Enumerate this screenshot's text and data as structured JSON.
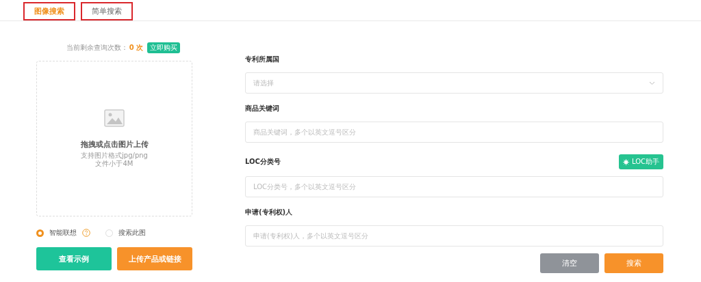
{
  "tabs": [
    {
      "label": "图像搜索",
      "selected": true,
      "annotated": true
    },
    {
      "label": "简单搜索",
      "selected": false,
      "annotated": true
    }
  ],
  "quota": {
    "label": "当前剩余查询次数：",
    "count": "0 次",
    "buy_button": "立即购买"
  },
  "upload": {
    "title": "拖拽或点击图片上传",
    "hint_lines": [
      "支持图片格式jpg/png",
      "文件小于4M"
    ]
  },
  "modes": [
    {
      "label": "智能联想",
      "selected": true,
      "help": true
    },
    {
      "label": "搜索此图",
      "selected": false,
      "help": false
    }
  ],
  "left_buttons": [
    {
      "label": "查看示例",
      "kind": "green"
    },
    {
      "label": "上传产品或链接",
      "kind": "orange"
    }
  ],
  "fields": [
    {
      "label": "专利所属国",
      "kind": "select",
      "placeholder": "请选择"
    },
    {
      "label": "商品关键词",
      "kind": "input",
      "placeholder": "商品关键词，多个以英文逗号区分"
    },
    {
      "label": "LOC分类号",
      "kind": "input",
      "placeholder": "LOC分类号，多个以英文逗号区分",
      "helper_button": "LOC助手"
    },
    {
      "label": "申请(专利权)人",
      "kind": "input",
      "placeholder": "申请(专利权)人，多个以英文逗号区分"
    }
  ],
  "actions": [
    {
      "label": "清空",
      "kind": "grey"
    },
    {
      "label": "搜索",
      "kind": "orange"
    }
  ]
}
